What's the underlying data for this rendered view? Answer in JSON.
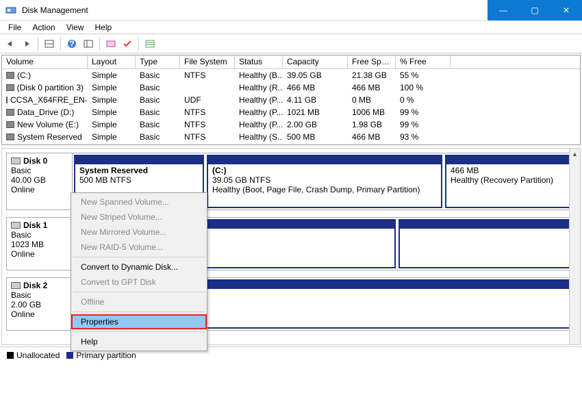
{
  "window": {
    "title": "Disk Management",
    "btn_min": "—",
    "btn_max": "▢",
    "btn_close": "✕"
  },
  "menubar": [
    "File",
    "Action",
    "View",
    "Help"
  ],
  "grid": {
    "headers": [
      "Volume",
      "Layout",
      "Type",
      "File System",
      "Status",
      "Capacity",
      "Free Spa...",
      "% Free"
    ],
    "rows": [
      {
        "volume": "(C:)",
        "layout": "Simple",
        "type": "Basic",
        "fs": "NTFS",
        "status": "Healthy (B...",
        "capacity": "39.05 GB",
        "free": "21.38 GB",
        "pfree": "55 %"
      },
      {
        "volume": "(Disk 0 partition 3)",
        "layout": "Simple",
        "type": "Basic",
        "fs": "",
        "status": "Healthy (R...",
        "capacity": "466 MB",
        "free": "466 MB",
        "pfree": "100 %"
      },
      {
        "volume": "CCSA_X64FRE_EN-...",
        "layout": "Simple",
        "type": "Basic",
        "fs": "UDF",
        "status": "Healthy (P...",
        "capacity": "4.11 GB",
        "free": "0 MB",
        "pfree": "0 %"
      },
      {
        "volume": "Data_Drive (D:)",
        "layout": "Simple",
        "type": "Basic",
        "fs": "NTFS",
        "status": "Healthy (P...",
        "capacity": "1021 MB",
        "free": "1006 MB",
        "pfree": "99 %"
      },
      {
        "volume": "New Volume (E:)",
        "layout": "Simple",
        "type": "Basic",
        "fs": "NTFS",
        "status": "Healthy (P...",
        "capacity": "2.00 GB",
        "free": "1.98 GB",
        "pfree": "99 %"
      },
      {
        "volume": "System Reserved",
        "layout": "Simple",
        "type": "Basic",
        "fs": "NTFS",
        "status": "Healthy (S...",
        "capacity": "500 MB",
        "free": "466 MB",
        "pfree": "93 %"
      }
    ]
  },
  "disks": [
    {
      "name": "Disk 0",
      "type": "Basic",
      "size": "40.00 GB",
      "status": "Online",
      "parts": [
        {
          "name": "System Reserved",
          "line2": "500 MB NTFS",
          "line3": "",
          "flex": "0 0 190px"
        },
        {
          "name": "(C:)",
          "line2": "39.05 GB NTFS",
          "line3": "Healthy (Boot, Page File, Crash Dump, Primary Partition)",
          "flex": "1"
        },
        {
          "name": "",
          "line2": "466 MB",
          "line3": "Healthy (Recovery Partition)",
          "flex": "0 0 188px"
        }
      ]
    },
    {
      "name": "Disk 1",
      "type": "Basic",
      "size": "1023 MB",
      "status": "Online",
      "parts": [
        {
          "name": "",
          "line2": "",
          "line3": "",
          "flex": "0 0 470px"
        },
        {
          "name": "",
          "line2": "",
          "line3": "",
          "flex": "1"
        }
      ]
    },
    {
      "name": "Disk 2",
      "type": "Basic",
      "size": "2.00 GB",
      "status": "Online",
      "parts": [
        {
          "name": "",
          "line2": "",
          "line3": "",
          "flex": "1"
        }
      ]
    }
  ],
  "context_menu": [
    {
      "label": "New Spanned Volume...",
      "enabled": false
    },
    {
      "label": "New Striped Volume...",
      "enabled": false
    },
    {
      "label": "New Mirrored Volume...",
      "enabled": false
    },
    {
      "label": "New RAID-5 Volume...",
      "enabled": false
    },
    {
      "sep": true
    },
    {
      "label": "Convert to Dynamic Disk...",
      "enabled": true
    },
    {
      "label": "Convert to GPT Disk",
      "enabled": false
    },
    {
      "sep": true
    },
    {
      "label": "Offline",
      "enabled": false
    },
    {
      "sep": true
    },
    {
      "label": "Properties",
      "enabled": true,
      "selected": true
    },
    {
      "sep": true
    },
    {
      "label": "Help",
      "enabled": true
    }
  ],
  "legend": {
    "unallocated": "Unallocated",
    "primary": "Primary partition"
  },
  "colors": {
    "titlebar_btn": "#0c79d4",
    "partition_border": "#1b2e88",
    "highlight": "#ff0000",
    "selection": "#90c8f6"
  }
}
